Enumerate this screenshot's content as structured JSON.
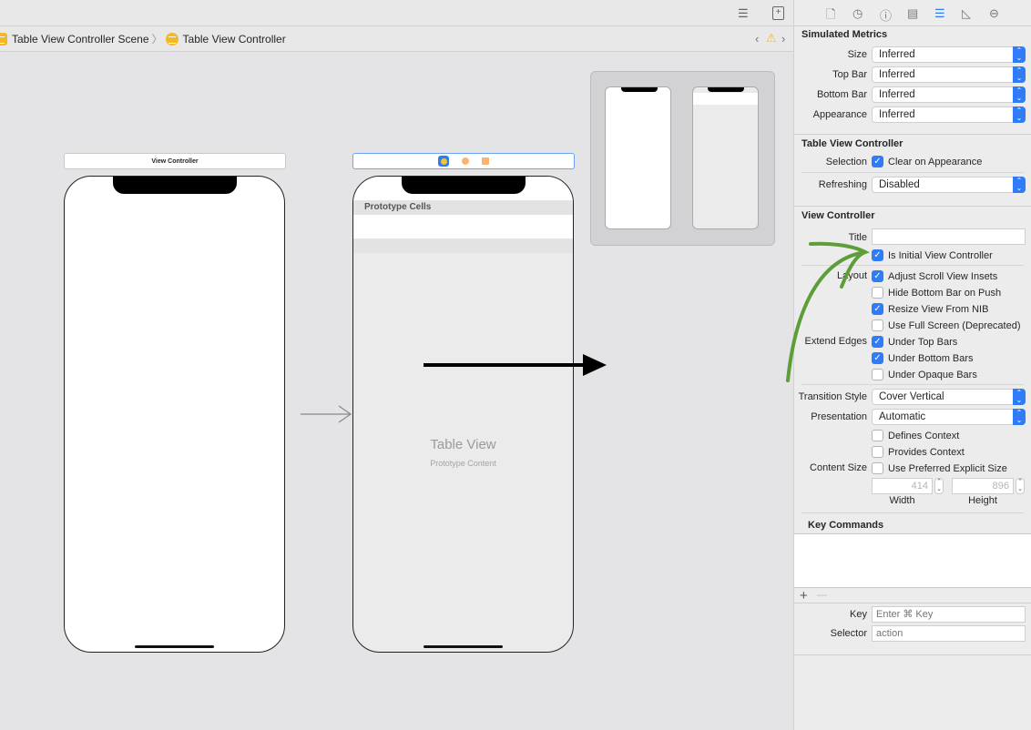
{
  "toolbar": {
    "icons": [
      "lines-icon",
      "add-editor-icon"
    ]
  },
  "breadcrumb": {
    "scene": "Table View Controller Scene",
    "controller": "Table View Controller",
    "separator": "〉"
  },
  "canvas": {
    "view_controller_title": "View Controller",
    "prototype_cells": "Prototype Cells",
    "table_view": "Table View",
    "prototype_content": "Prototype Content"
  },
  "inspector": {
    "tabs": [
      "file-icon",
      "history-icon",
      "help-icon",
      "identity-icon",
      "attributes-icon",
      "size-icon",
      "connections-icon"
    ],
    "simulated_metrics": {
      "heading": "Simulated Metrics",
      "rows": [
        {
          "label": "Size",
          "value": "Inferred"
        },
        {
          "label": "Top Bar",
          "value": "Inferred"
        },
        {
          "label": "Bottom Bar",
          "value": "Inferred"
        },
        {
          "label": "Appearance",
          "value": "Inferred"
        }
      ]
    },
    "table_view_controller": {
      "heading": "Table View Controller",
      "selection_label": "Selection",
      "clear_on_appearance": "Clear on Appearance",
      "refreshing_label": "Refreshing",
      "refreshing_value": "Disabled"
    },
    "view_controller": {
      "heading": "View Controller",
      "title_label": "Title",
      "title_value": "",
      "is_initial": "Is Initial View Controller",
      "layout_label": "Layout",
      "adjust_scroll": "Adjust Scroll View Insets",
      "hide_bottom": "Hide Bottom Bar on Push",
      "resize_nib": "Resize View From NIB",
      "full_screen": "Use Full Screen (Deprecated)",
      "extend_label": "Extend Edges",
      "under_top": "Under Top Bars",
      "under_bottom": "Under Bottom Bars",
      "under_opaque": "Under Opaque Bars",
      "transition_label": "Transition Style",
      "transition_value": "Cover Vertical",
      "presentation_label": "Presentation",
      "presentation_value": "Automatic",
      "defines_context": "Defines Context",
      "provides_context": "Provides Context",
      "content_size_label": "Content Size",
      "preferred_size": "Use Preferred Explicit Size",
      "width_value": "414",
      "height_value": "896",
      "width_label": "Width",
      "height_label": "Height"
    },
    "key_commands": {
      "heading": "Key Commands",
      "key_label": "Key",
      "key_placeholder": "Enter ⌘ Key",
      "selector_label": "Selector",
      "selector_placeholder": "action",
      "add": "+",
      "remove": "—"
    }
  },
  "colors": {
    "accent": "#2f7cf6",
    "annotation": "#5e9e3a"
  }
}
